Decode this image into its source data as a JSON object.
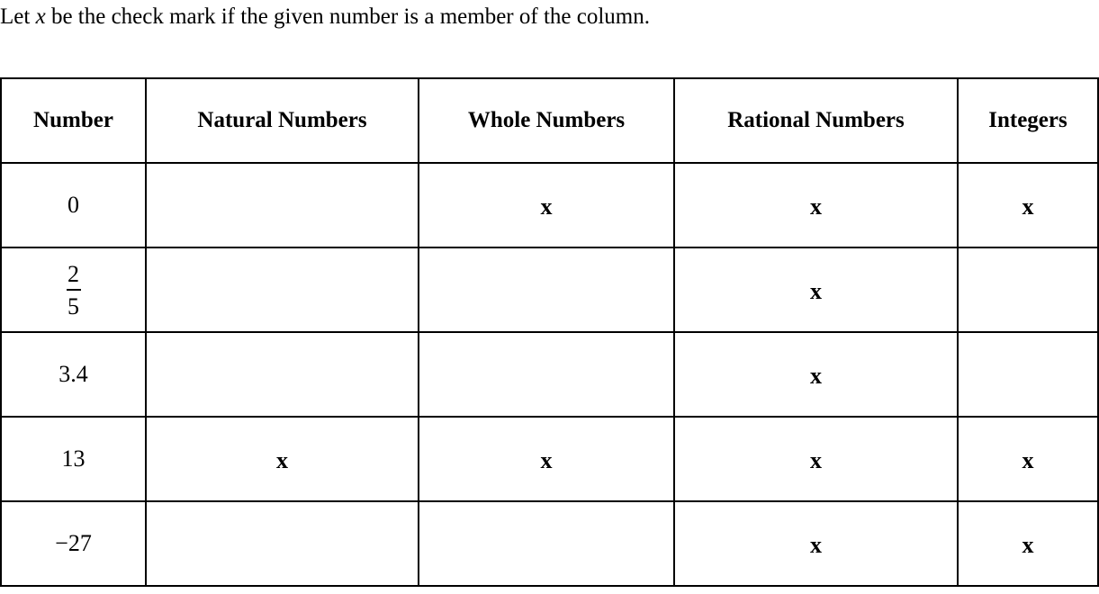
{
  "instruction": {
    "prefix": "Let ",
    "variable": "x",
    "suffix": " be the check mark if the given number is a member of the column."
  },
  "table": {
    "headers": [
      "Number",
      "Natural Numbers",
      "Whole Numbers",
      "Rational Numbers",
      "Integers"
    ],
    "mark_symbol": "x",
    "rows": [
      {
        "number": "0",
        "is_fraction": false,
        "natural": "",
        "whole": "x",
        "rational": "x",
        "integer": "x"
      },
      {
        "number": "2/5",
        "is_fraction": true,
        "numerator": "2",
        "denominator": "5",
        "natural": "",
        "whole": "",
        "rational": "x",
        "integer": ""
      },
      {
        "number": "3.4",
        "is_fraction": false,
        "natural": "",
        "whole": "",
        "rational": "x",
        "integer": ""
      },
      {
        "number": "13",
        "is_fraction": false,
        "natural": "x",
        "whole": "x",
        "rational": "x",
        "integer": "x"
      },
      {
        "number": "−27",
        "is_fraction": false,
        "natural": "",
        "whole": "",
        "rational": "x",
        "integer": "x"
      }
    ]
  }
}
